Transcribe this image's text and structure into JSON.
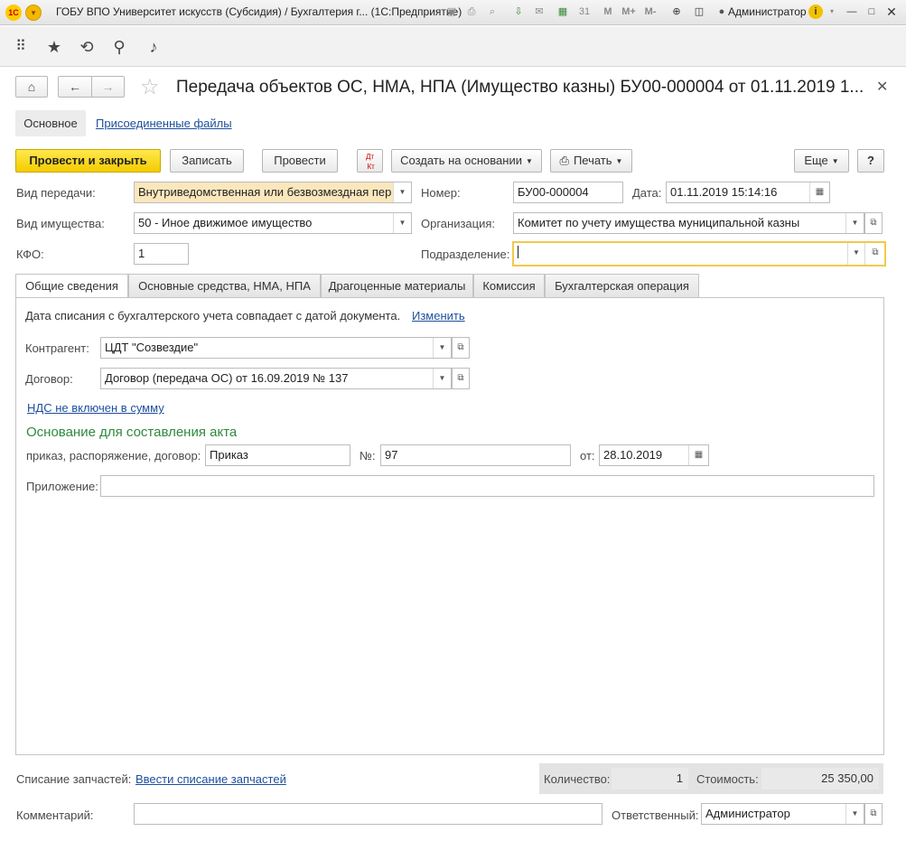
{
  "window": {
    "title": "ГОБУ ВПО Университет искусств (Субсидия) / Бухгалтерия г...  (1С:Предприятие)",
    "user": "Администратор",
    "mbuttons": [
      "M",
      "M+",
      "M-"
    ]
  },
  "document": {
    "title": "Передача объектов ОС, НМА, НПА (Имущество казны) БУ00-000004 от 01.11.2019 1...",
    "nav_tabs": [
      "Основное",
      "Присоединенные файлы"
    ]
  },
  "commands": {
    "post_close": "Провести и закрыть",
    "save": "Записать",
    "post": "Провести",
    "dt_kt": "Дт Кт",
    "create_based": "Создать на основании",
    "print": "Печать",
    "more": "Еще",
    "help": "?"
  },
  "header": {
    "transfer_type_label": "Вид передачи:",
    "transfer_type_value": "Внутриведомственная или безвозмездная пер",
    "property_type_label": "Вид имущества:",
    "property_type_value": "50 - Иное движимое имущество",
    "kfo_label": "КФО:",
    "kfo_value": "1",
    "number_label": "Номер:",
    "number_value": "БУ00-000004",
    "date_label": "Дата:",
    "date_value": "01.11.2019 15:14:16",
    "org_label": "Организация:",
    "org_value": "Комитет по учету имущества муниципальной казны",
    "dept_label": "Подразделение:",
    "dept_value": ""
  },
  "tabs": [
    "Общие сведения",
    "Основные средства, НМА, НПА",
    "Драгоценные материалы",
    "Комиссия",
    "Бухгалтерская операция"
  ],
  "general": {
    "writeoff_note": "Дата списания с бухгалтерского учета совпадает с датой документа.",
    "change_link": "Изменить",
    "counterparty_label": "Контрагент:",
    "counterparty_value": "ЦДТ \"Созвездие\"",
    "contract_label": "Договор:",
    "contract_value": "Договор (передача ОС) от 16.09.2019 № 137",
    "vat_link": "НДС не включен в сумму",
    "basis_heading": "Основание для составления акта",
    "basis_label": "приказ, распоряжение, договор:",
    "basis_value": "Приказ",
    "no_label": "№:",
    "no_value": "97",
    "from_label": "от:",
    "from_value": "28.10.2019",
    "attachment_label": "Приложение:",
    "attachment_value": ""
  },
  "footer": {
    "parts_label": "Списание запчастей:",
    "parts_link": "Ввести списание запчастей",
    "qty_label": "Количество:",
    "qty_value": "1",
    "cost_label": "Стоимость:",
    "cost_value": "25 350,00",
    "comment_label": "Комментарий:",
    "comment_value": "",
    "responsible_label": "Ответственный:",
    "responsible_value": "Администратор"
  }
}
